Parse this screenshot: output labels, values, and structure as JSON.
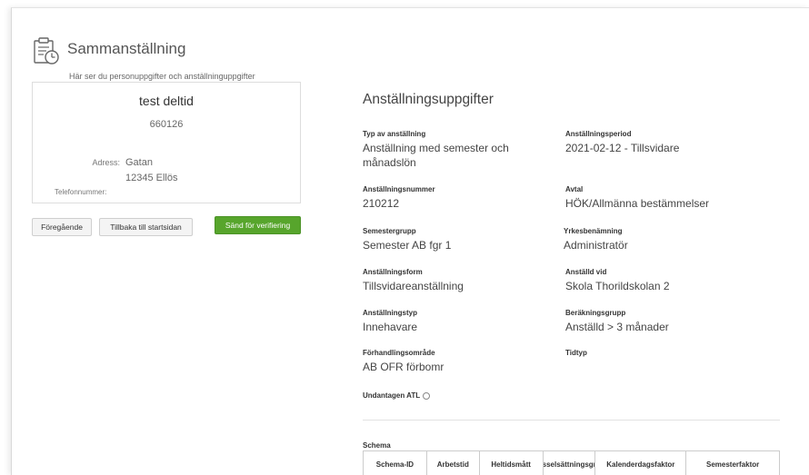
{
  "header": {
    "title": "Sammanställning",
    "subtitle": "Här ser du personuppgifter och anställninguppgifter"
  },
  "person": {
    "name": "test deltid",
    "id": "660126",
    "address_label": "Adress:",
    "address_line1": "Gatan",
    "address_line2": "12345 Ellös",
    "phone_label": "Telefonnummer:"
  },
  "buttons": {
    "previous": "Föregående",
    "back_home": "Tillbaka till startsidan",
    "send_verify": "Sänd för verifiering"
  },
  "employment": {
    "section_title": "Anställningsuppgifter",
    "typ_label": "Typ av anställning",
    "typ_value": "Anställning med semester och månadslön",
    "period_label": "Anställningsperiod",
    "period_value": "2021-02-12 - Tillsvidare",
    "nummer_label": "Anställningsnummer",
    "nummer_value": "210212",
    "avtal_label": "Avtal",
    "avtal_value": "HÖK/Allmänna bestämmelser",
    "semestergrupp_label": "Semestergrupp",
    "semestergrupp_value": "Semester AB fgr 1",
    "yrke_label": "Yrkesbenämning",
    "yrke_value": "Administratör",
    "form_label": "Anställningsform",
    "form_value": "Tillsvidareanställning",
    "vid_label": "Anställd vid",
    "vid_value": "Skola Thorildskolan 2",
    "typ2_label": "Anställningstyp",
    "typ2_value": "Innehavare",
    "berakning_label": "Beräkningsgrupp",
    "berakning_value": "Anställd > 3 månader",
    "forhandling_label": "Förhandlingsområde",
    "forhandling_value": "AB OFR förbomr",
    "tidtyp_label": "Tidtyp",
    "atl_label": "Undantagen ATL"
  },
  "schema": {
    "label": "Schema",
    "columns": [
      "Schema-ID",
      "Arbetstid",
      "Heltidsmått",
      "Sysselsättningsgrad",
      "Kalenderdagsfaktor",
      "Semesterfaktor"
    ]
  },
  "icons": {
    "header": "clipboard-clock-icon"
  },
  "colors": {
    "send_button": "#57a52c"
  }
}
